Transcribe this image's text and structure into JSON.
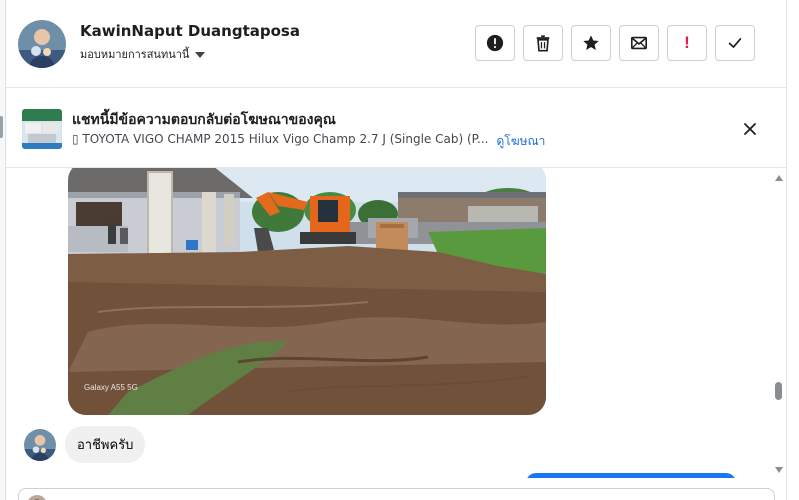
{
  "header": {
    "contact_name": "KawinNaput Duangtaposa",
    "assign_label": "มอบหมายการสนทนานี้",
    "actions": [
      {
        "name": "report-button",
        "icon": "alert-circle-icon",
        "label": ""
      },
      {
        "name": "delete-button",
        "icon": "trash-icon",
        "label": ""
      },
      {
        "name": "star-button",
        "icon": "star-icon",
        "label": ""
      },
      {
        "name": "mark-unread-button",
        "icon": "envelope-icon",
        "label": ""
      },
      {
        "name": "follow-up-button",
        "icon": "exclamation-icon",
        "label": "!"
      },
      {
        "name": "mark-done-button",
        "icon": "check-icon",
        "label": ""
      }
    ]
  },
  "ad": {
    "title": "แชทนี้มีข้อความตอบกลับต่อโฆษณาของคุณ",
    "subtitle": "▯ TOYOTA VIGO CHAMP 2015 Hilux Vigo Champ 2.7 J (Single Cab) (P...",
    "link": "ดูโฆษณา"
  },
  "messages": {
    "photo_watermark": "Galaxy A55 5G",
    "incoming_text": "อาชีพครับ"
  },
  "colors": {
    "accent": "#1877f2",
    "link": "#216fdb",
    "danger": "#e41e3f",
    "bubble": "#f0f0f0"
  }
}
